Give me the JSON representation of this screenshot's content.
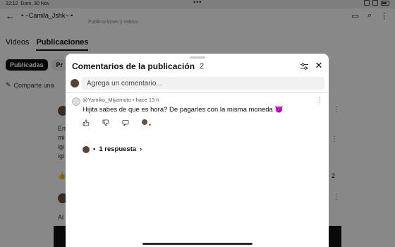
{
  "status_bar": {
    "time": "12:12",
    "date": "Dom, 30 Nov",
    "dots": "•••"
  },
  "page": {
    "back_icon": "arrow-left-icon",
    "channel_name": "• ~Camila_Jshk~ •",
    "subtitle": "Publicaciones y videos",
    "tabs": [
      "Videos",
      "Publicaciones"
    ],
    "chips": [
      "Publicadas",
      "Pr"
    ],
    "share_label": "Comparte una",
    "posts": [
      {
        "lines": [
          "Em",
          "mi",
          "igi",
          "igi"
        ],
        "likes": "2"
      },
      {
        "lines": [
          "Al"
        ]
      }
    ]
  },
  "sheet": {
    "title": "Comentarios de la publicación",
    "count": "2",
    "add_placeholder": "Agrega un comentario...",
    "comment": {
      "author": "@Yamiko_Miyamoto",
      "time": "hace 13 h",
      "text": "Hijita sabes de que es hora? De pagarles con la misma moneda 😈"
    },
    "replies_label": "1 respuesta"
  }
}
